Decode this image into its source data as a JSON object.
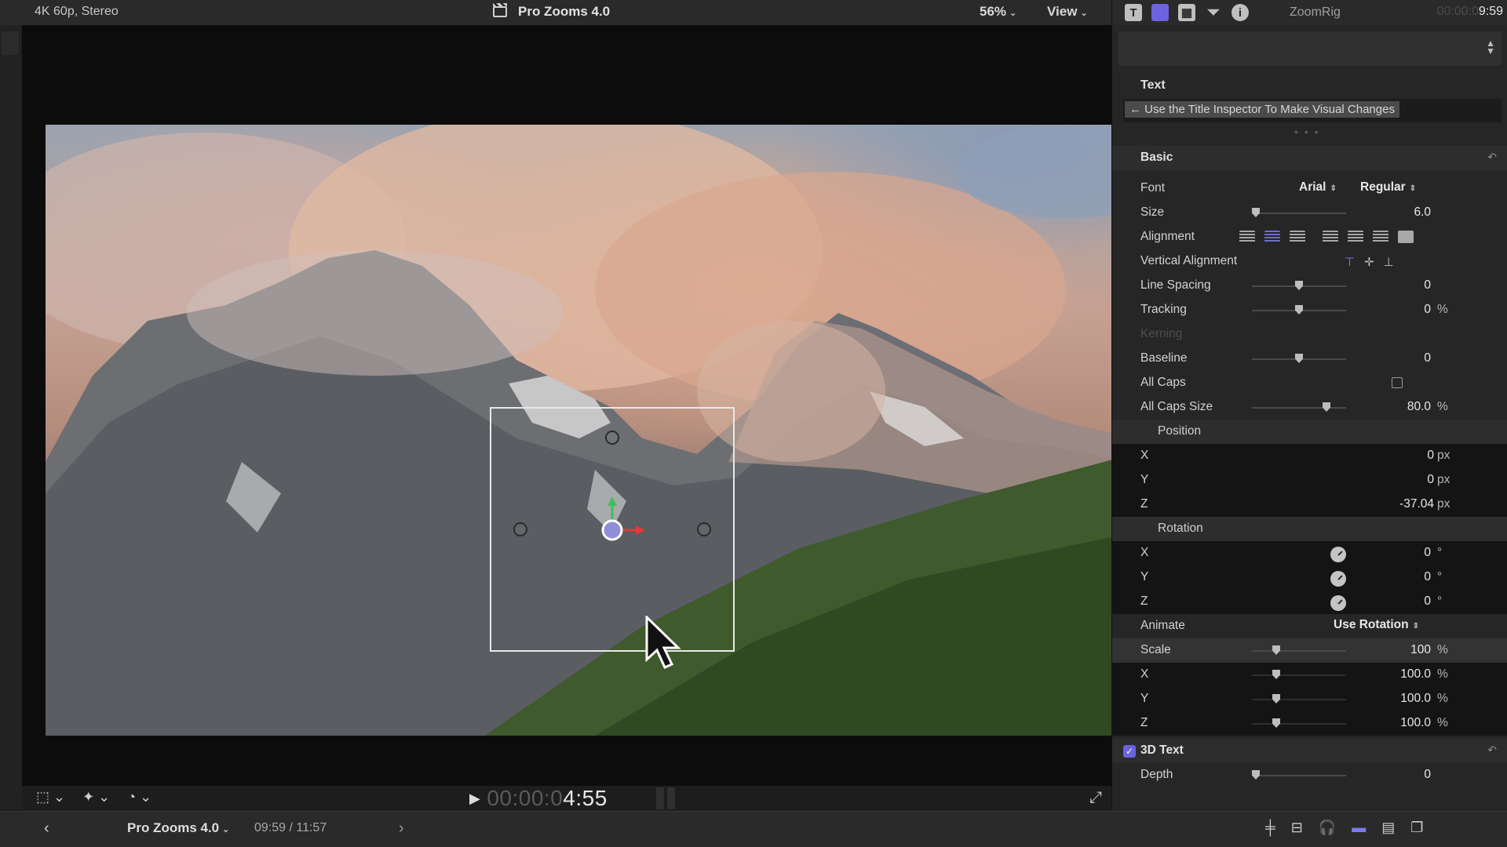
{
  "viewer": {
    "format": "4K 60p, Stereo",
    "project": "Pro Zooms 4.0",
    "zoom": "56%",
    "view": "View"
  },
  "transport": {
    "timecode_dim": "00:00:0",
    "timecode": "4:55"
  },
  "timeline": {
    "project": "Pro Zooms 4.0",
    "duration": "09:59 / 11:57"
  },
  "inspector": {
    "title": "ZoomRig",
    "time_dim": "00:00:0",
    "time": "9:59",
    "text_header": "Text",
    "text_hint": "← Use the Title Inspector To Make Visual Changes",
    "basic": {
      "header": "Basic",
      "font_label": "Font",
      "font": "Arial",
      "font_style": "Regular",
      "size_label": "Size",
      "size": "6.0",
      "size_level": 0.05,
      "alignment_label": "Alignment",
      "vertical_alignment_label": "Vertical Alignment",
      "line_spacing_label": "Line Spacing",
      "line_spacing": "0",
      "tracking_label": "Tracking",
      "tracking": "0",
      "tracking_unit": "%",
      "kerning_label": "Kerning",
      "baseline_label": "Baseline",
      "baseline": "0",
      "all_caps_label": "All Caps",
      "all_caps": false,
      "all_caps_size_label": "All Caps Size",
      "all_caps_size": "80.0",
      "all_caps_size_unit": "%"
    },
    "position": {
      "header": "Position",
      "x_label": "X",
      "x": "0",
      "x_unit": "px",
      "y_label": "Y",
      "y": "0",
      "y_unit": "px",
      "z_label": "Z",
      "z": "-37.04",
      "z_unit": "px"
    },
    "rotation": {
      "header": "Rotation",
      "x_label": "X",
      "x": "0",
      "x_unit": "°",
      "y_label": "Y",
      "y": "0",
      "y_unit": "°",
      "z_label": "Z",
      "z": "0",
      "z_unit": "°",
      "animate_label": "Animate",
      "animate": "Use Rotation"
    },
    "scale": {
      "label": "Scale",
      "value": "100",
      "unit": "%",
      "x_label": "X",
      "x": "100.0",
      "x_unit": "%",
      "y_label": "Y",
      "y": "100.0",
      "y_unit": "%",
      "z_label": "Z",
      "z": "100.0",
      "z_unit": "%"
    },
    "text3d": {
      "label": "3D Text",
      "enabled": true,
      "depth_label": "Depth",
      "depth": "0"
    }
  },
  "colors": {
    "accent": "#6c63e0",
    "inspector_bg": "#262626",
    "viewer_bg": "#0c0c0c"
  },
  "icons": [
    "text-inspector-icon",
    "video-inspector-icon",
    "film-inspector-icon",
    "filter-inspector-icon",
    "info-icon",
    "transform-icon",
    "enhance-icon",
    "retime-icon",
    "play-icon",
    "fullscreen-icon",
    "back-icon",
    "forward-icon",
    "headphones-icon"
  ]
}
